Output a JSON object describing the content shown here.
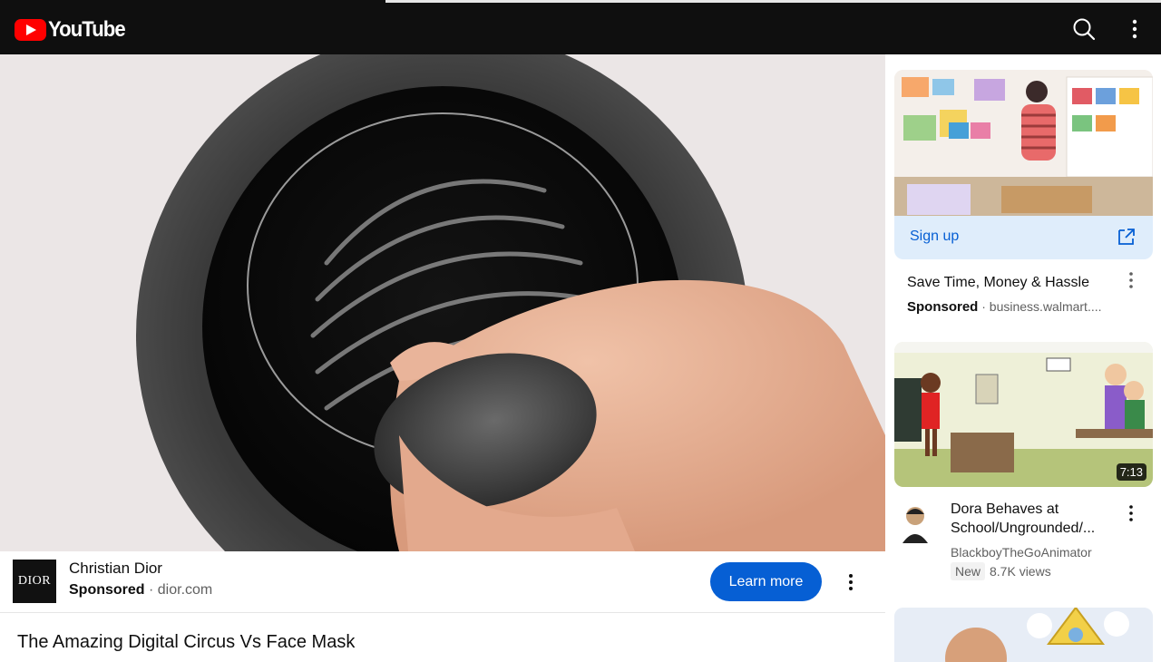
{
  "header": {
    "logo_text": "YouTube",
    "icons": [
      "search-icon",
      "more-vert-icon"
    ]
  },
  "ad": {
    "logo_text": "DIOR",
    "advertiser": "Christian Dior",
    "sponsored": "Sponsored",
    "domain": "dior.com",
    "cta": "Learn more"
  },
  "video": {
    "title": "The Amazing Digital Circus Vs Face Mask"
  },
  "sidebar": {
    "sponsored_card": {
      "cta": "Sign up",
      "title": "Save Time, Money & Hassle",
      "sponsored": "Sponsored",
      "domain": "business.walmart...."
    },
    "videos": [
      {
        "duration": "7:13",
        "title": "Dora Behaves at School/Ungrounded/...",
        "channel": "BlackboyTheGoAnimator",
        "badge": "New",
        "views": "8.7K views"
      }
    ]
  },
  "colors": {
    "topbar": "#0f0f0f",
    "brand_red": "#ff0000",
    "cta_blue": "#065fd4",
    "signup_bar": "#dfedfb"
  }
}
